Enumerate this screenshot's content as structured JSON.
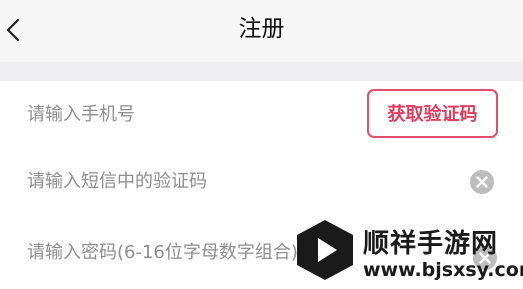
{
  "header": {
    "title": "注册",
    "back_icon": "chevron-left-icon"
  },
  "form": {
    "phone_placeholder": "请输入手机号",
    "get_code_label": "获取验证码",
    "sms_code_placeholder": "请输入短信中的验证码",
    "password_placeholder": "请输入密码(6-16位字母数字组合)",
    "clear_icon": "clear-circle-icon"
  },
  "watermark": {
    "name": "顺祥手游网",
    "url": "www.bjsxsy.com"
  },
  "colors": {
    "accent": "#e23b5c",
    "header_bg": "#f7f7f7",
    "section_gap": "#efeff1",
    "placeholder": "#8e8e8e",
    "divider": "#e2e2e2"
  }
}
